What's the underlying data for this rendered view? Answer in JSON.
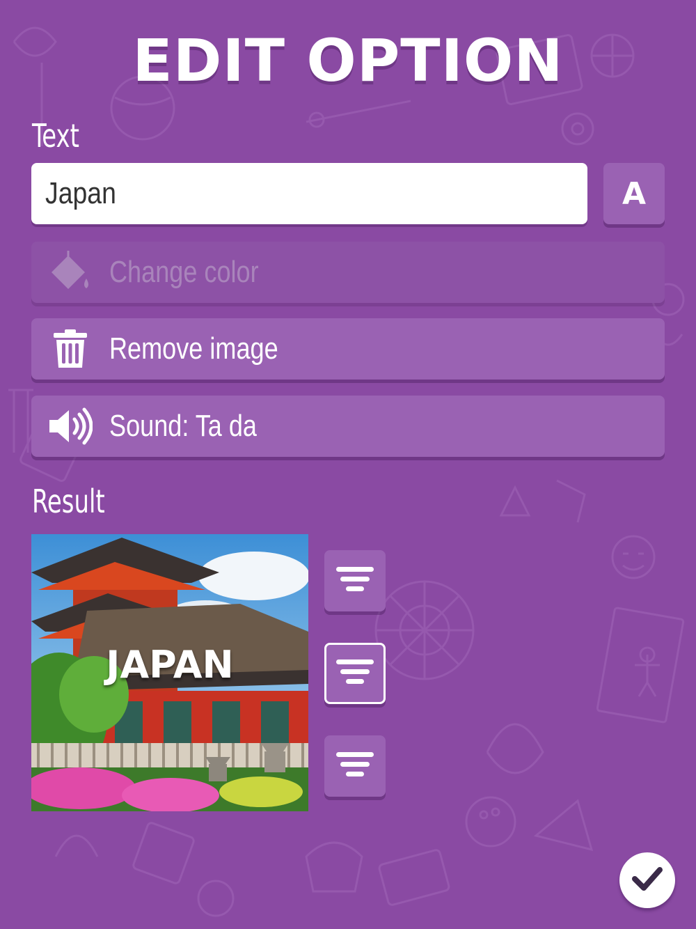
{
  "header": {
    "title": "EDIT OPTION"
  },
  "text_section": {
    "label": "Text",
    "input_value": "Japan",
    "font_button": "A"
  },
  "actions": {
    "change_color": "Change color",
    "remove_image": "Remove image",
    "sound": "Sound: Ta da"
  },
  "result_section": {
    "label": "Result",
    "caption": "JAPAN"
  },
  "icons": {
    "font": "font-icon",
    "paint_bucket": "paint-bucket-icon",
    "trash": "trash-icon",
    "speaker": "speaker-icon",
    "align_top": "align-top-icon",
    "align_middle": "align-middle-icon",
    "align_bottom": "align-bottom-icon",
    "check": "check-icon"
  },
  "colors": {
    "background": "#8a4aa3",
    "button": "#9a62b3",
    "accent": "#3a2a48"
  }
}
